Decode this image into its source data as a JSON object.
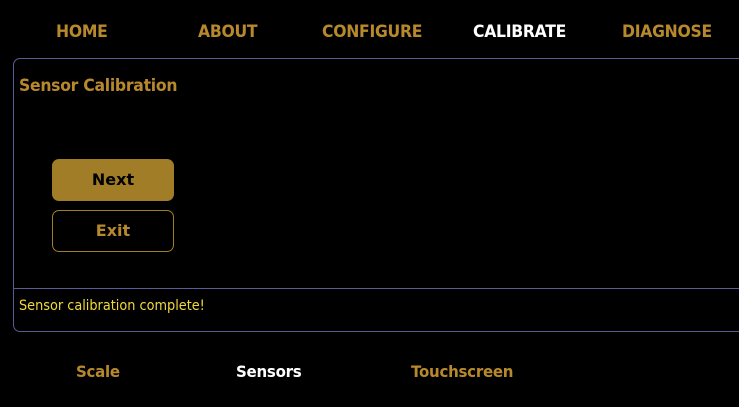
{
  "colors": {
    "background": "#000000",
    "accent_gold": "#b8892c",
    "active_white": "#ffffff",
    "status_yellow": "#f2d93a",
    "panel_border": "#5a5a96",
    "button_fill": "#a07d26",
    "button_text": "#000000"
  },
  "top_nav": {
    "items": [
      {
        "label": "HOME",
        "active": false
      },
      {
        "label": "ABOUT",
        "active": false
      },
      {
        "label": "CONFIGURE",
        "active": false
      },
      {
        "label": "CALIBRATE",
        "active": true
      },
      {
        "label": "DIAGNOSE",
        "active": false
      }
    ]
  },
  "panel": {
    "title": "Sensor Calibration",
    "next_label": "Next",
    "exit_label": "Exit",
    "status": "Sensor calibration complete!"
  },
  "bottom_nav": {
    "items": [
      {
        "label": "Scale",
        "active": false
      },
      {
        "label": "Sensors",
        "active": true
      },
      {
        "label": "Touchscreen",
        "active": false
      }
    ]
  }
}
